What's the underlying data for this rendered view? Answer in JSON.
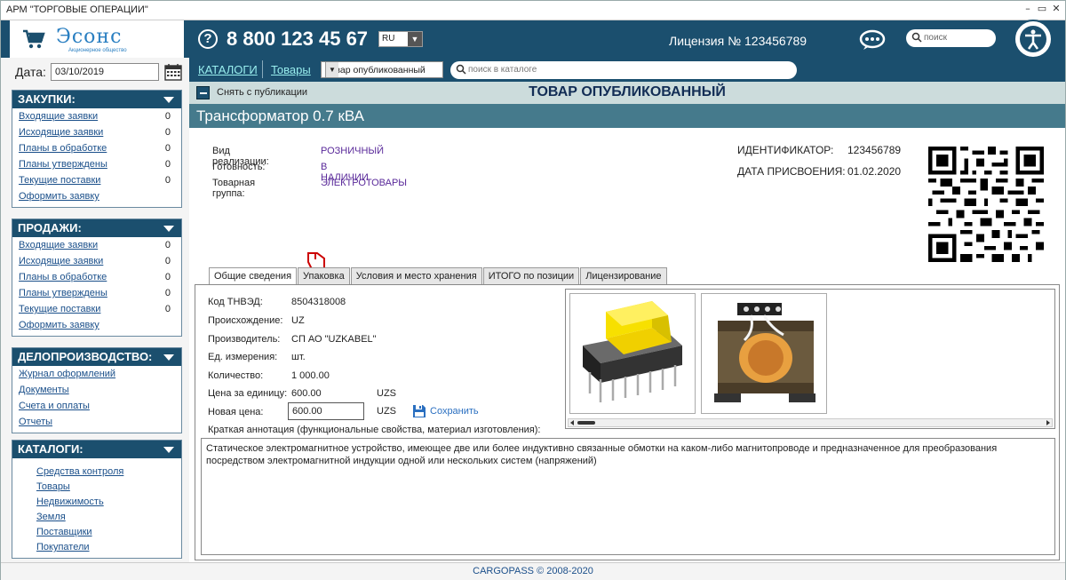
{
  "window": {
    "title": "АРМ \"ТОРГОВЫЕ ОПЕРАЦИИ\""
  },
  "header": {
    "logo_text": "Эсонс",
    "logo_subtext": "Акционерное общество",
    "phone": "8 800 123 45 67",
    "lang": "RU",
    "license": "Лицензия № 123456789",
    "search_placeholder": "поиск",
    "accent": "#1b4f6e"
  },
  "sidebar": {
    "date_label": "Дата:",
    "date_value": "03/10/2019",
    "panels": [
      {
        "title": "ЗАКУПКИ:",
        "items": [
          {
            "label": "Входящие заявки",
            "count": "0"
          },
          {
            "label": "Исходящие заявки",
            "count": "0"
          },
          {
            "label": "Планы в обработке",
            "count": "0"
          },
          {
            "label": "Планы утверждены",
            "count": "0"
          },
          {
            "label": "Текущие поставки",
            "count": "0"
          },
          {
            "label": "Оформить заявку",
            "count": ""
          }
        ]
      },
      {
        "title": "ПРОДАЖИ:",
        "items": [
          {
            "label": "Входящие заявки",
            "count": "0"
          },
          {
            "label": "Исходящие заявки",
            "count": "0"
          },
          {
            "label": "Планы в обработке",
            "count": "0"
          },
          {
            "label": "Планы утверждены",
            "count": "0"
          },
          {
            "label": "Текущие поставки",
            "count": "0"
          },
          {
            "label": "Оформить заявку",
            "count": ""
          }
        ]
      },
      {
        "title": "ДЕЛОПРОИЗВОДСТВО:",
        "items": [
          {
            "label": "Журнал оформлений",
            "count": ""
          },
          {
            "label": "Документы",
            "count": ""
          },
          {
            "label": "Счета и оплаты",
            "count": ""
          },
          {
            "label": "Отчеты",
            "count": ""
          }
        ]
      },
      {
        "title": "КАТАЛОГИ:",
        "items": [
          {
            "label": "Средства контроля",
            "count": ""
          },
          {
            "label": "Товары",
            "count": ""
          },
          {
            "label": "Недвижимость",
            "count": ""
          },
          {
            "label": "Земля",
            "count": ""
          },
          {
            "label": "Поставщики",
            "count": ""
          },
          {
            "label": "Покупатели",
            "count": ""
          }
        ]
      }
    ]
  },
  "nav": {
    "catalogs": "КАТАЛОГИ",
    "goods": "Товары",
    "status_select": "Товар опубликованный",
    "search_placeholder": "поиск в каталоге"
  },
  "pubbar": {
    "unpublish_label": "Снять с публикации",
    "title": "ТОВАР ОПУБЛИКОВАННЫЙ"
  },
  "product": {
    "title": "Трансформатор 0.7 кВА",
    "attrs": [
      {
        "k": "Вид реализации:",
        "v": "РОЗНИЧНЫЙ"
      },
      {
        "k": "Готовность:",
        "v": "В НАЛИЧИИ"
      },
      {
        "k": "Товарная группа:",
        "v": "ЭЛЕКТРОТОВАРЫ"
      }
    ],
    "ident_label": "ИДЕНТИФИКАТОР:",
    "ident_value": "123456789",
    "date_label": "ДАТА ПРИСВОЕНИЯ:",
    "date_value": "01.02.2020"
  },
  "tabs": [
    "Общие сведения",
    "Упаковка",
    "Условия и место хранения",
    "ИТОГО по позиции",
    "Лицензирование"
  ],
  "general": {
    "fields": [
      {
        "k": "Код ТНВЭД:",
        "v": "8504318008"
      },
      {
        "k": "Происхождение:",
        "v": "UZ"
      },
      {
        "k": "Производитель:",
        "v": "СП АО \"UZKABEL\""
      },
      {
        "k": "Ед. измерения:",
        "v": "шт."
      },
      {
        "k": "Количество:",
        "v": "1 000.00"
      },
      {
        "k": "Цена за единицу:",
        "v": "600.00"
      }
    ],
    "currency": "UZS",
    "new_price_label": "Новая цена:",
    "new_price_value": "600.00",
    "save_label": "Сохранить",
    "annotation_label": "Краткая аннотация (функциональные свойства, материал изготовления):",
    "annotation": "Статическое электромагнитное устройство, имеющее две или более индуктивно связанные обмотки на каком-либо магнитопроводе и предназначенное для преобразования посредством электромагнитной индукции одной или нескольких систем (напряжений)"
  },
  "footer": "CARGOPASS © 2008-2020"
}
